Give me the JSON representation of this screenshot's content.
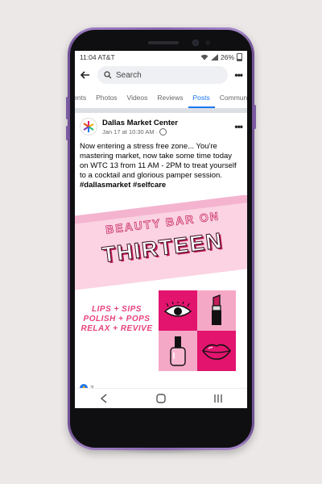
{
  "status_bar": {
    "time": "11:04",
    "carrier": "AT&T",
    "battery": "26%"
  },
  "search": {
    "placeholder": "Search"
  },
  "tabs": [
    {
      "label": "ents",
      "active": false
    },
    {
      "label": "Photos",
      "active": false
    },
    {
      "label": "Videos",
      "active": false
    },
    {
      "label": "Reviews",
      "active": false
    },
    {
      "label": "Posts",
      "active": true
    },
    {
      "label": "Community",
      "active": false
    }
  ],
  "post": {
    "page_name": "Dallas Market Center",
    "timestamp": "Jan 17 at 10:30 AM",
    "text": "Now entering a stress free zone... You're mastering market, now take some time today on WTC 13 from 11 AM - 2PM to treat yourself to a cocktail and glorious pamper session.",
    "hashtags": "#dallasmarket #selfcare",
    "reaction_count": "3"
  },
  "image": {
    "title_line1": "BEAUTY BAR ON",
    "title_line2": "THIRTEEN",
    "tagline": [
      "LIPS + SIPS",
      "POLISH + POPS",
      "RELAX + REVIVE"
    ],
    "tiles": [
      "eye-icon",
      "lipstick-icon",
      "nail-polish-icon",
      "lips-icon"
    ]
  },
  "colors": {
    "accent": "#1877f2",
    "pink_dark": "#e3146e",
    "pink_light": "#f5a7c6",
    "phone_body": "#8b67b0"
  }
}
